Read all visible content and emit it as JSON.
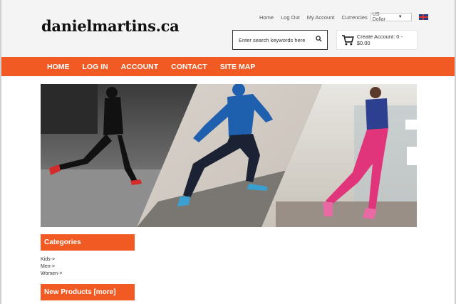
{
  "header": {
    "logo": "danielmartins.ca",
    "top_links": [
      "Home",
      "Log Out",
      "My Account"
    ],
    "currencies_label": "Currencies",
    "currency_selected": "US Dollar",
    "search_placeholder": "Enter search keywords here",
    "cart_text": "Create Account: 0 - $0.00"
  },
  "nav": {
    "items": [
      "HOME",
      "LOG IN",
      "ACCOUNT",
      "CONTACT",
      "SITE MAP"
    ]
  },
  "sidebar": {
    "categories_title": "Categories",
    "categories": [
      "Kids->",
      "Men->",
      "Women->"
    ],
    "new_products_title": "New Products  [more]"
  },
  "colors": {
    "accent": "#f15a22",
    "header_bg": "#f4f4f4"
  }
}
